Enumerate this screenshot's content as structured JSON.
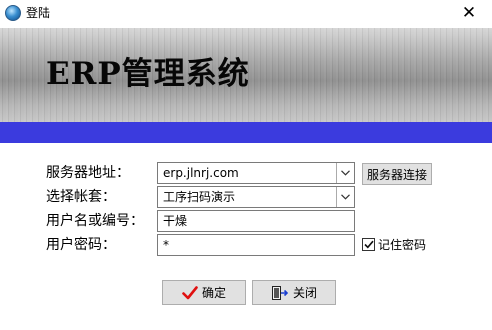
{
  "window": {
    "title": "登陆",
    "icon": "globe-icon",
    "close_glyph": "✕"
  },
  "banner": {
    "title": "ERP管理系统",
    "accent_color": "#3b3bde"
  },
  "form": {
    "server": {
      "label": "服务器地址：",
      "value": "erp.jlnrj.com"
    },
    "account": {
      "label": "选择帐套：",
      "value": "工序扫码演示"
    },
    "username": {
      "label": "用户名或编号：",
      "value": "干燥"
    },
    "password": {
      "label": "用户密码：",
      "value": "*"
    },
    "connect_button": "服务器连接",
    "remember": {
      "label": "记住密码",
      "checked": true
    }
  },
  "buttons": {
    "ok": {
      "label": "确定",
      "icon": "checkmark-icon",
      "icon_color": "#e01010"
    },
    "close": {
      "label": "关闭",
      "icon": "exit-door-icon"
    }
  }
}
